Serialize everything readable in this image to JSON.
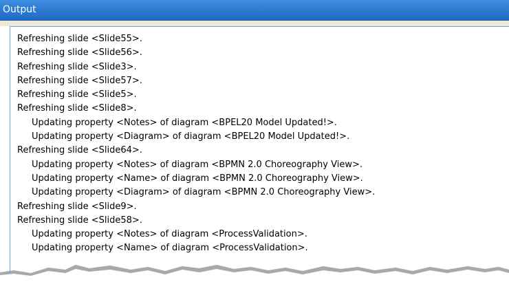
{
  "window": {
    "title": "Output"
  },
  "log": {
    "lines": [
      {
        "text": "Refreshing slide <Slide55>.",
        "indent": false
      },
      {
        "text": "Refreshing slide <Slide56>.",
        "indent": false
      },
      {
        "text": "Refreshing slide <Slide3>.",
        "indent": false
      },
      {
        "text": "Refreshing slide <Slide57>.",
        "indent": false
      },
      {
        "text": "Refreshing slide <Slide5>.",
        "indent": false
      },
      {
        "text": "Refreshing slide <Slide8>.",
        "indent": false
      },
      {
        "text": "Updating property <Notes> of diagram <BPEL20 Model Updated!>.",
        "indent": true
      },
      {
        "text": "Updating property <Diagram> of diagram <BPEL20 Model Updated!>.",
        "indent": true
      },
      {
        "text": "Refreshing slide <Slide64>.",
        "indent": false
      },
      {
        "text": "Updating property <Notes> of diagram <BPMN 2.0 Choreography View>.",
        "indent": true
      },
      {
        "text": "Updating property <Name> of diagram <BPMN 2.0 Choreography View>.",
        "indent": true
      },
      {
        "text": "Updating property <Diagram> of diagram <BPMN 2.0 Choreography View>.",
        "indent": true
      },
      {
        "text": "Refreshing slide <Slide9>.",
        "indent": false
      },
      {
        "text": "Refreshing slide <Slide58>.",
        "indent": false
      },
      {
        "text": "Updating property <Notes> of diagram <ProcessValidation>.",
        "indent": true
      },
      {
        "text": "Updating property <Name> of diagram <ProcessValidation>.",
        "indent": true
      }
    ]
  },
  "colors": {
    "title_bar": "#2f7bd3",
    "title_text": "#ffffff",
    "log_text": "#000000",
    "torn_shadow": "#9a9a9a"
  }
}
